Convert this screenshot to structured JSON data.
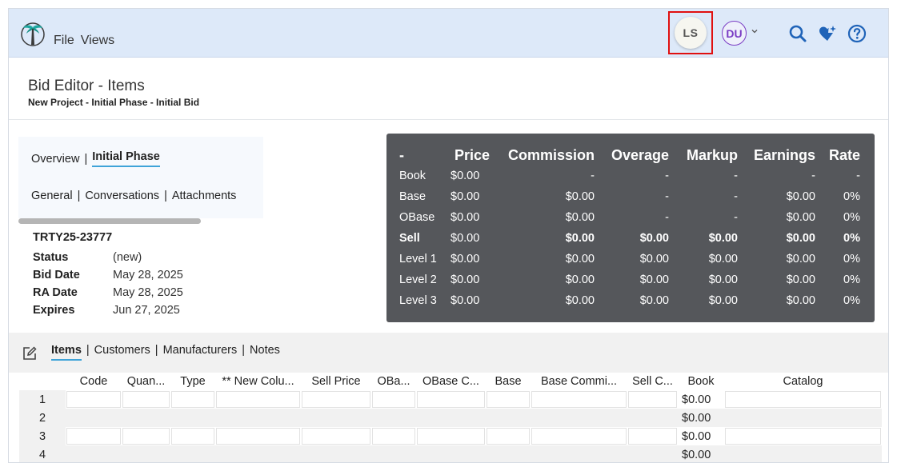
{
  "menu": {
    "file": "File",
    "views": "Views"
  },
  "users": {
    "current": "LS",
    "other": "DU"
  },
  "page": {
    "title": "Bid Editor - Items",
    "breadcrumb": "New Project - Initial Phase - Initial Bid"
  },
  "nav": {
    "overview": "Overview",
    "phase": "Initial Phase",
    "general": "General",
    "conversations": "Conversations",
    "attachments": "Attachments"
  },
  "details": {
    "id": "TRTY25-23777",
    "rows": [
      {
        "k": "Status",
        "v": "(new)"
      },
      {
        "k": "Bid Date",
        "v": "May 28, 2025"
      },
      {
        "k": "RA Date",
        "v": "May 28, 2025"
      },
      {
        "k": "Expires",
        "v": "Jun 27, 2025"
      }
    ]
  },
  "summary": {
    "headers": [
      "-",
      "Price",
      "Commission",
      "Overage",
      "Markup",
      "Earnings",
      "Rate"
    ],
    "rows": [
      [
        "Book",
        "$0.00",
        "-",
        "-",
        "-",
        "-",
        "-"
      ],
      [
        "Base",
        "$0.00",
        "$0.00",
        "-",
        "-",
        "$0.00",
        "0%"
      ],
      [
        "OBase",
        "$0.00",
        "$0.00",
        "-",
        "-",
        "$0.00",
        "0%"
      ],
      [
        "Sell",
        "$0.00",
        "$0.00",
        "$0.00",
        "$0.00",
        "$0.00",
        "0%"
      ],
      [
        "Level 1",
        "$0.00",
        "$0.00",
        "$0.00",
        "$0.00",
        "$0.00",
        "0%"
      ],
      [
        "Level 2",
        "$0.00",
        "$0.00",
        "$0.00",
        "$0.00",
        "$0.00",
        "0%"
      ],
      [
        "Level 3",
        "$0.00",
        "$0.00",
        "$0.00",
        "$0.00",
        "$0.00",
        "0%"
      ]
    ]
  },
  "items_tabs": {
    "items": "Items",
    "customers": "Customers",
    "manufacturers": "Manufacturers",
    "notes": "Notes"
  },
  "grid": {
    "columns": [
      "",
      "Code",
      "Quan...",
      "Type",
      "** New Colu...",
      "Sell Price",
      "OBa...",
      "OBase C...",
      "Base",
      "Base Commi...",
      "Sell C...",
      "Book",
      "Catalog"
    ],
    "rows": [
      {
        "n": "1",
        "book": "$0.00"
      },
      {
        "n": "2",
        "book": "$0.00"
      },
      {
        "n": "3",
        "book": "$0.00"
      },
      {
        "n": "4",
        "book": "$0.00"
      }
    ]
  },
  "colors": {
    "topbar": "#dde9f9",
    "accent": "#3fa3d8",
    "summary_bg": "#55575b",
    "highlight": "#e01010",
    "du": "#7a3cc4",
    "icons": "#1f63b8"
  }
}
